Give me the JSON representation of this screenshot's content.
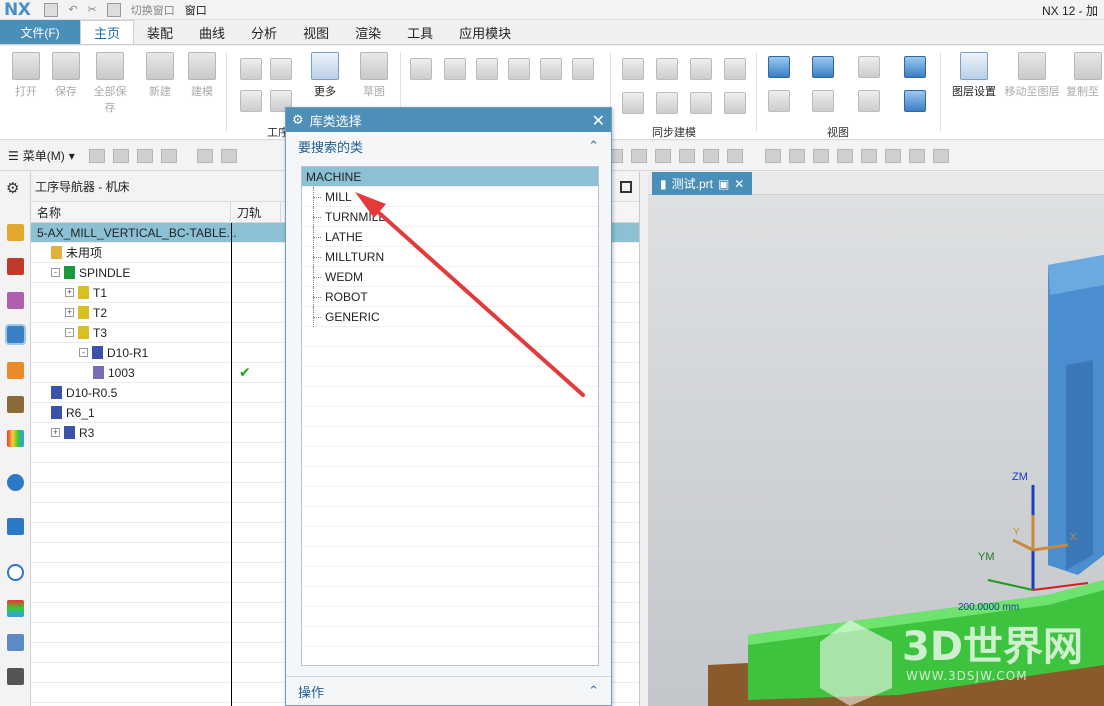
{
  "app": {
    "logo": "NX",
    "title": "NX 12 - 加",
    "quick_access": {
      "switch_window": "切换窗口",
      "window": "窗口"
    }
  },
  "menu": {
    "file": "文件(F)",
    "tabs": [
      "主页",
      "装配",
      "曲线",
      "分析",
      "视图",
      "渲染",
      "工具",
      "应用模块"
    ],
    "active_tab": "主页"
  },
  "ribbon": {
    "buttons": [
      "打开",
      "保存",
      "全部保存",
      "新建",
      "建模"
    ],
    "more": "更多",
    "sketch": "草图",
    "layer_settings": "图层设置",
    "move_to_layer": "移动至图层",
    "copy_to_layer": "复制至",
    "groups": {
      "ops": "工序",
      "sync": "同步建模",
      "view": "视图"
    }
  },
  "toolbar": {
    "menu_label": "菜单(M)"
  },
  "navigator": {
    "title": "工序导航器 - 机床",
    "columns": [
      "名称",
      "刀轨"
    ],
    "rows": [
      {
        "label": "5-AX_MILL_VERTICAL_BC-TABLE...",
        "level": 0,
        "selected": true,
        "icon": "machine-icon",
        "expander": ""
      },
      {
        "label": "未用项",
        "level": 1,
        "icon": "folder-icon",
        "expander": ""
      },
      {
        "label": "SPINDLE",
        "level": 1,
        "icon": "spindle-icon",
        "expander": "-"
      },
      {
        "label": "T1",
        "level": 2,
        "icon": "tool-holder-icon",
        "expander": "+"
      },
      {
        "label": "T2",
        "level": 2,
        "icon": "tool-holder-icon",
        "expander": "+"
      },
      {
        "label": "T3",
        "level": 2,
        "icon": "tool-holder-icon",
        "expander": "-"
      },
      {
        "label": "D10-R1",
        "level": 3,
        "icon": "mill-tool-icon",
        "expander": "-"
      },
      {
        "label": "1003",
        "level": 4,
        "icon": "operation-icon",
        "expander": "",
        "check": "✔"
      },
      {
        "label": "D10-R0.5",
        "level": 1,
        "icon": "mill-tool-icon",
        "expander": ""
      },
      {
        "label": "R6_1",
        "level": 1,
        "icon": "mill-tool-icon",
        "expander": ""
      },
      {
        "label": "R3",
        "level": 1,
        "icon": "mill-tool-icon",
        "expander": "+"
      }
    ]
  },
  "graphics": {
    "tab_label": "测试.prt",
    "axis_labels": {
      "zm": "ZM",
      "ym": "YM",
      "y": "Y",
      "x": "X"
    },
    "dimension": "200.0000 mm"
  },
  "dialog": {
    "title": "库类选择",
    "section_search": "要搜索的类",
    "header_item": "MACHINE",
    "items": [
      "MILL",
      "TURNMILL",
      "LATHE",
      "MILLTURN",
      "WEDM",
      "ROBOT",
      "GENERIC"
    ],
    "section_ops": "操作"
  },
  "watermark": {
    "brand": "3D世界网",
    "url": "WWW.3DSJW.COM"
  },
  "colors": {
    "accent": "#4a8fb8",
    "selection": "#8cc1d5",
    "arrow": "#e23b3b",
    "table_green": "#3ec33e"
  }
}
